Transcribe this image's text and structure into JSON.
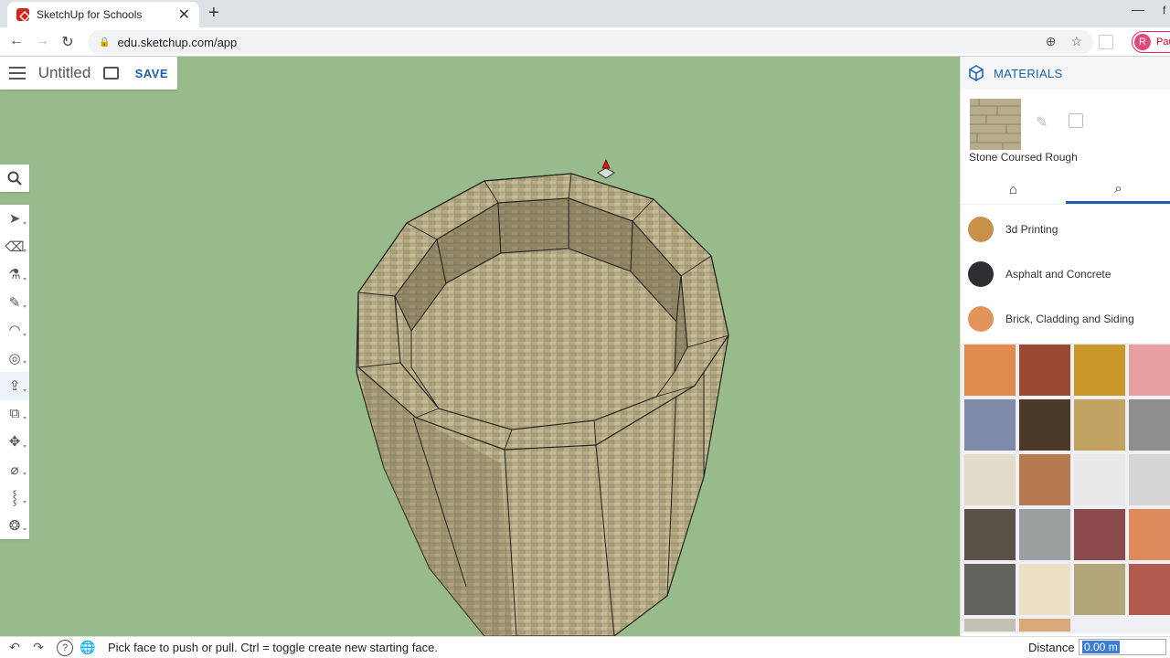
{
  "browser": {
    "tab_title": "SketchUp for Schools",
    "tab_close": "✕",
    "new_tab": "+",
    "minimize": "—",
    "edge_glyph": "f",
    "url": "edu.sketchup.com/app",
    "profile_initial": "R",
    "profile_name": "Pau"
  },
  "app": {
    "doc_title": "Untitled",
    "save_label": "SAVE"
  },
  "tools": [
    {
      "name": "select-tool",
      "icon": "arrow-cursor-icon",
      "glyph": "➤"
    },
    {
      "name": "eraser-tool",
      "icon": "eraser-icon",
      "glyph": "⌫"
    },
    {
      "name": "paint-bucket-tool",
      "icon": "paint-bucket-icon",
      "glyph": "⚗"
    },
    {
      "name": "line-tool",
      "icon": "pencil-icon",
      "glyph": "✎"
    },
    {
      "name": "arc-tool",
      "icon": "arc-icon",
      "glyph": "◠"
    },
    {
      "name": "circle-tool",
      "icon": "circle-icon",
      "glyph": "◎"
    },
    {
      "name": "push-pull-tool",
      "icon": "push-pull-icon",
      "glyph": "⇪",
      "active": true
    },
    {
      "name": "offset-tool",
      "icon": "offset-icon",
      "glyph": "⧉"
    },
    {
      "name": "move-tool",
      "icon": "move-icon",
      "glyph": "✥"
    },
    {
      "name": "tape-measure-tool",
      "icon": "tape-measure-icon",
      "glyph": "⌀"
    },
    {
      "name": "walk-tool",
      "icon": "footprints-icon",
      "glyph": "⸾"
    },
    {
      "name": "orbit-tool",
      "icon": "orbit-icon",
      "glyph": "❂"
    }
  ],
  "status": {
    "message": "Pick face to push or pull. Ctrl = toggle create new starting face.",
    "distance_label": "Distance",
    "distance_value": "0.00 m",
    "help_glyph": "?"
  },
  "materials": {
    "title": "MATERIALS",
    "current_name": "Stone Coursed Rough",
    "categories": [
      {
        "label": "3d Printing",
        "color": "#c8914a"
      },
      {
        "label": "Asphalt and Concrete",
        "color": "#2f2f33"
      },
      {
        "label": "Brick, Cladding and Siding",
        "color": "#e39458"
      }
    ],
    "swatch_colors": [
      "#e08a4e",
      "#9a4a33",
      "#c7972a",
      "#e8a0a0",
      "#7d8aa8",
      "#4b3a2a",
      "#c2a260",
      "#8e8e8e",
      "#e3dccb",
      "#b57a4f",
      "#e9e9e9",
      "#d6d6d6",
      "#5a5248",
      "#9aa0a0",
      "#8a4a4e",
      "#de8a5a",
      "#62625e",
      "#ece0c4",
      "#b2a578",
      "#b25a4e",
      "#c4c0b4",
      "#d8a878"
    ]
  },
  "colors": {
    "viewport_bg": "#98bb8b",
    "accent": "#1a5fa8"
  }
}
